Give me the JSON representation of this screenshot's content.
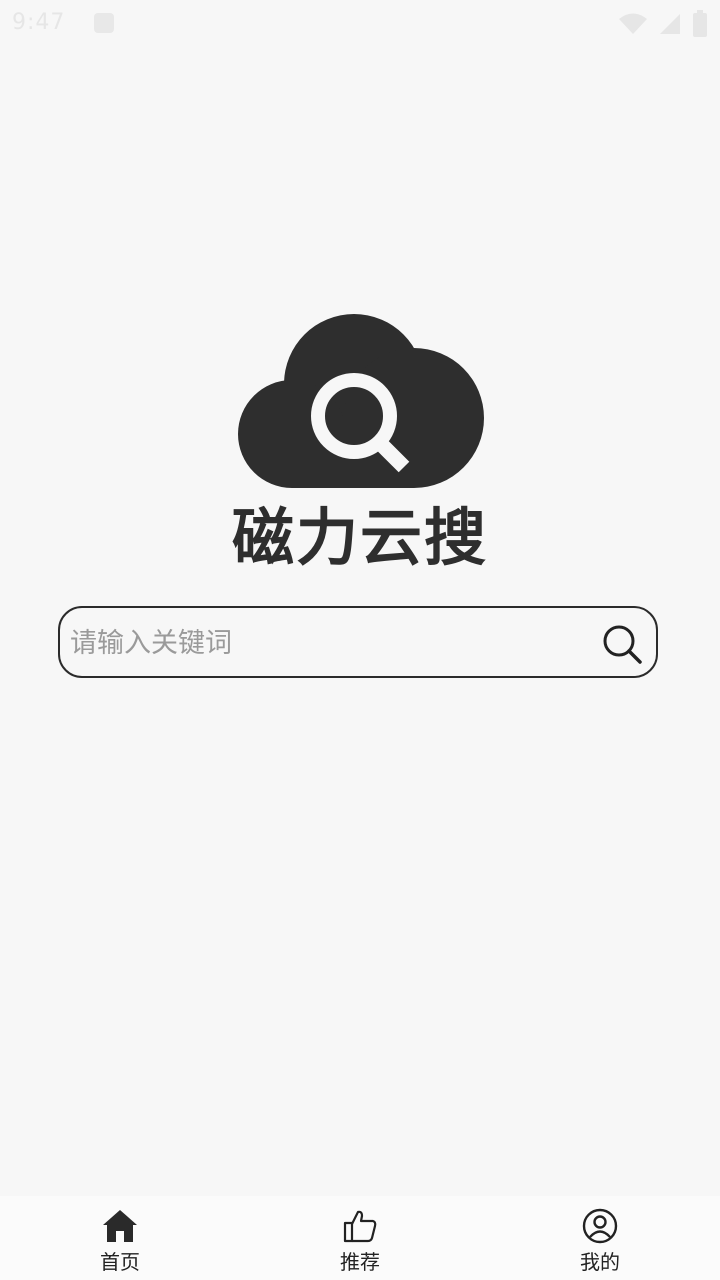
{
  "status_bar": {
    "time": "9:47"
  },
  "app": {
    "title": "磁力云搜"
  },
  "search": {
    "placeholder": "请输入关键词",
    "value": ""
  },
  "bottom_nav": {
    "items": [
      {
        "label": "首页",
        "icon": "home-icon",
        "active": true
      },
      {
        "label": "推荐",
        "icon": "thumbs-up-icon",
        "active": false
      },
      {
        "label": "我的",
        "icon": "user-circle-icon",
        "active": false
      }
    ]
  }
}
